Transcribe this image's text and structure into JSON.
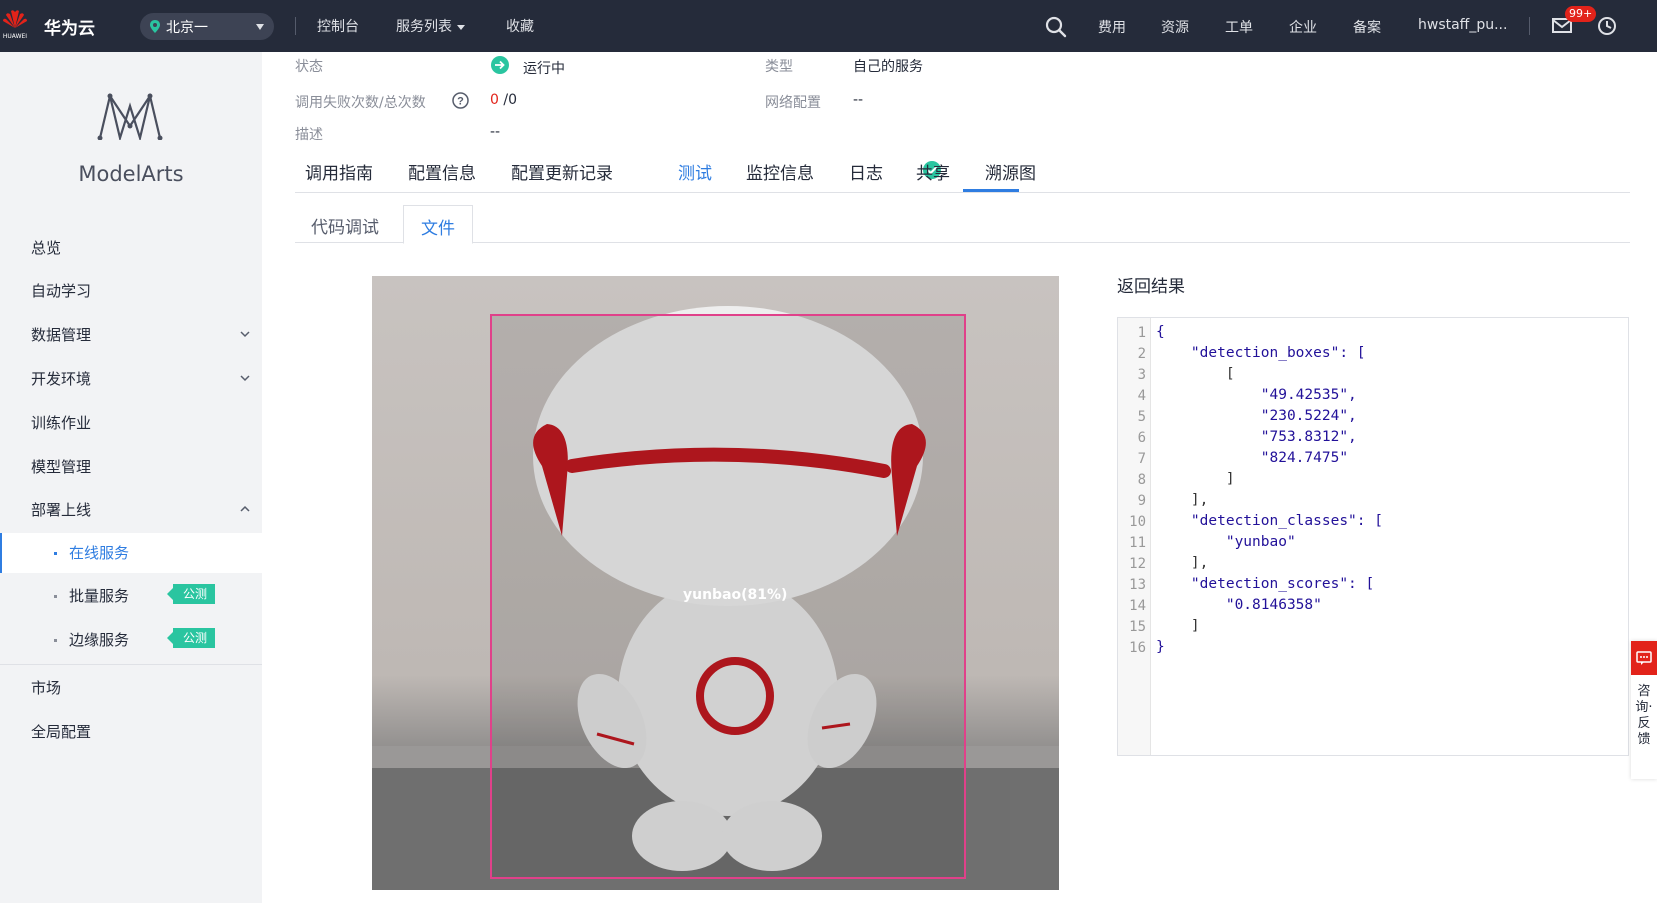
{
  "topbar": {
    "logo_text": "HUAWEI",
    "brand": "华为云",
    "region": "北京一",
    "nav": [
      "控制台",
      "服务列表",
      "收藏"
    ],
    "right_links": [
      "费用",
      "资源",
      "工单",
      "企业",
      "备案",
      "hwstaff_pu..."
    ],
    "badge": "99+"
  },
  "sidebar": {
    "app_name": "ModelArts",
    "items": [
      "总览",
      "自动学习",
      "数据管理",
      "开发环境",
      "训练作业",
      "模型管理",
      "部署上线"
    ],
    "sub_items": [
      "在线服务",
      "批量服务",
      "边缘服务"
    ],
    "tag": "公测",
    "bottom_items": [
      "市场",
      "全局配置"
    ]
  },
  "info": {
    "status_label": "状态",
    "status_value": "运行中",
    "type_label": "类型",
    "type_value": "自己的服务",
    "calls_label": "调用失败次数/总次数",
    "calls_fail": "0",
    "calls_total": " /0",
    "network_label": "网络配置",
    "network_value": "--",
    "desc_label": "描述",
    "desc_value": "--"
  },
  "tabs": [
    "调用指南",
    "配置信息",
    "配置更新记录",
    "测试",
    "监控信息",
    "日志",
    "共享",
    "溯源图"
  ],
  "subtabs": [
    "代码调试",
    "文件"
  ],
  "image": {
    "detection_label": "yunbao(81%)"
  },
  "result": {
    "title": "返回结果",
    "line_numbers": [
      "1",
      "2",
      "3",
      "4",
      "5",
      "6",
      "7",
      "8",
      "9",
      "10",
      "11",
      "12",
      "13",
      "14",
      "15",
      "16"
    ],
    "lines": [
      "{",
      "    \"detection_boxes\": [",
      "        [",
      "            \"49.42535\",",
      "            \"230.5224\",",
      "            \"753.8312\",",
      "            \"824.7475\"",
      "        ]",
      "    ],",
      "    \"detection_classes\": [",
      "        \"yunbao\"",
      "    ],",
      "    \"detection_scores\": [",
      "        \"0.8146358\"",
      "    ]",
      "}"
    ]
  },
  "feedback": {
    "text": "咨询·反馈"
  },
  "colors": {
    "accent": "#2f7de1",
    "topbar": "#252b3a",
    "tag": "#2ac5a0",
    "bbox": "#e0418a"
  }
}
